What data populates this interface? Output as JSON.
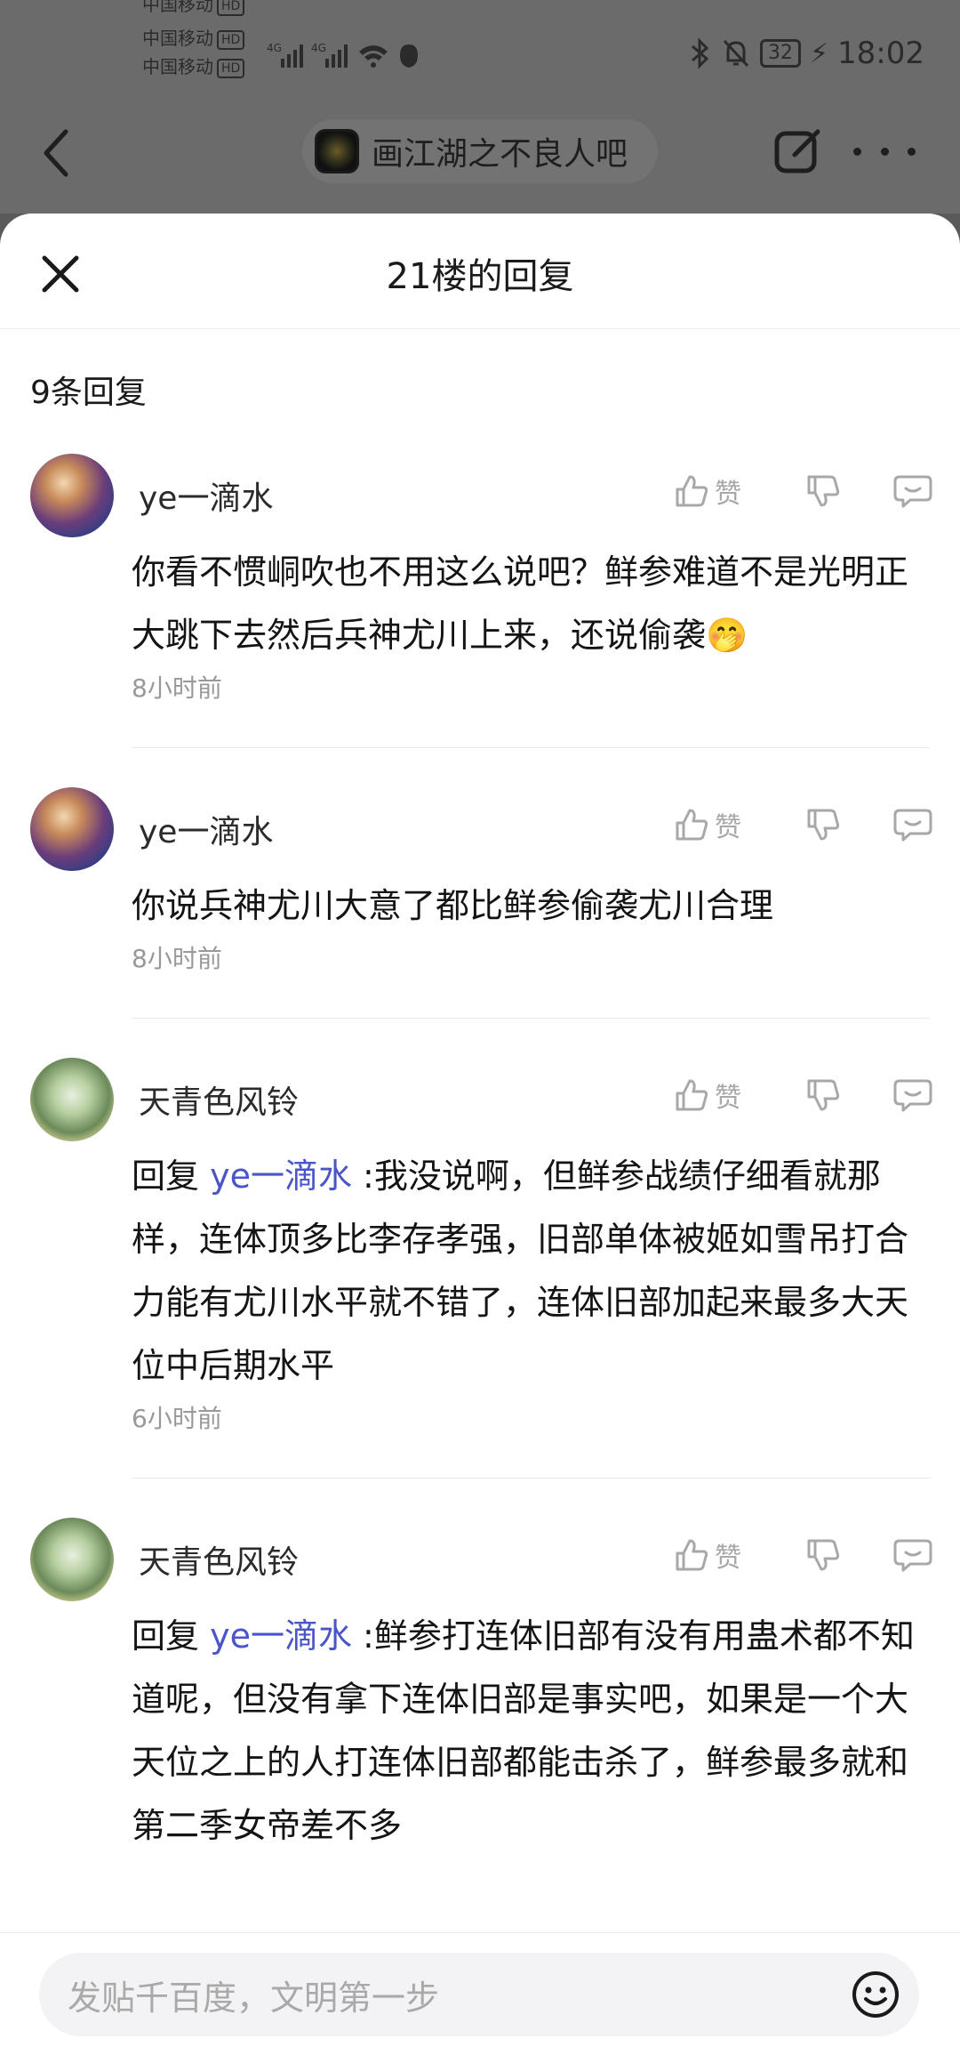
{
  "status_bar": {
    "carriers": [
      "中国移动",
      "中国移动",
      "中国移动"
    ],
    "hd": "HD",
    "battery": "32",
    "time": "18:02"
  },
  "nav": {
    "forum_title": "画江湖之不良人吧"
  },
  "sheet": {
    "title": "21楼的回复",
    "reply_count": "9条回复"
  },
  "actions": {
    "like_label": "赞"
  },
  "replies": [
    {
      "username": "ye一滴水",
      "mention": "",
      "text": "你看不惯峒吹也不用这么说吧？鲜参难道不是光明正大跳下去然后兵神尤川上来，还说偷袭",
      "emoji": "🤭",
      "time": "8小时前"
    },
    {
      "username": "ye一滴水",
      "mention": "",
      "text": "你说兵神尤川大意了都比鲜参偷袭尤川合理",
      "emoji": "",
      "time": "8小时前"
    },
    {
      "username": "天青色风铃",
      "reply_prefix": "回复 ",
      "mention": "ye一滴水",
      "text": " :我没说啊，但鲜参战绩仔细看就那样，连体顶多比李存孝强，旧部单体被姬如雪吊打合力能有尤川水平就不错了，连体旧部加起来最多大天位中后期水平",
      "emoji": "",
      "time": "6小时前"
    },
    {
      "username": "天青色风铃",
      "reply_prefix": "回复 ",
      "mention": "ye一滴水",
      "text": " :鲜参打连体旧部有没有用蛊术都不知道呢，但没有拿下连体旧部是事实吧，如果是一个大天位之上的人打连体旧部都能击杀了，鲜参最多就和第二季女帝差不多",
      "emoji": "",
      "time": ""
    }
  ],
  "input": {
    "placeholder": "发贴千百度，文明第一步"
  }
}
